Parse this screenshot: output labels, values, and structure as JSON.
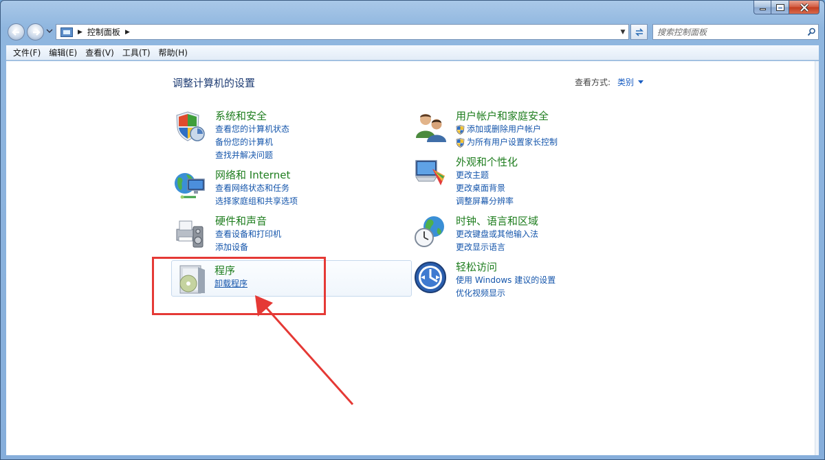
{
  "window": {
    "buttons": {
      "minimize": "minimize",
      "maximize": "maximize",
      "close": "close"
    }
  },
  "address": {
    "crumbs": [
      "控制面板"
    ],
    "search_placeholder": "搜索控制面板"
  },
  "menu": [
    "文件(F)",
    "编辑(E)",
    "查看(V)",
    "工具(T)",
    "帮助(H)"
  ],
  "content": {
    "title": "调整计算机的设置",
    "view_by_label": "查看方式:",
    "view_by_value": "类别",
    "categories": [
      {
        "title": "系统和安全",
        "links": [
          "查看您的计算机状态",
          "备份您的计算机",
          "查找并解决问题"
        ],
        "icon": "system-security-icon"
      },
      {
        "title": "网络和 Internet",
        "links": [
          "查看网络状态和任务",
          "选择家庭组和共享选项"
        ],
        "icon": "network-icon"
      },
      {
        "title": "硬件和声音",
        "links": [
          "查看设备和打印机",
          "添加设备"
        ],
        "icon": "hardware-sound-icon"
      },
      {
        "title": "程序",
        "links": [
          "卸载程序"
        ],
        "icon": "programs-icon"
      },
      {
        "title": "用户帐户和家庭安全",
        "links": [
          "添加或删除用户帐户",
          "为所有用户设置家长控制"
        ],
        "icon": "user-accounts-icon"
      },
      {
        "title": "外观和个性化",
        "links": [
          "更改主题",
          "更改桌面背景",
          "调整屏幕分辨率"
        ],
        "icon": "appearance-icon"
      },
      {
        "title": "时钟、语言和区域",
        "links": [
          "更改键盘或其他输入法",
          "更改显示语言"
        ],
        "icon": "clock-region-icon"
      },
      {
        "title": "轻松访问",
        "links": [
          "使用 Windows 建议的设置",
          "优化视频显示"
        ],
        "icon": "ease-of-access-icon"
      }
    ]
  },
  "colors": {
    "category_title": "#1e7d1e",
    "link": "#1455ab",
    "annotation": "#e53935"
  }
}
